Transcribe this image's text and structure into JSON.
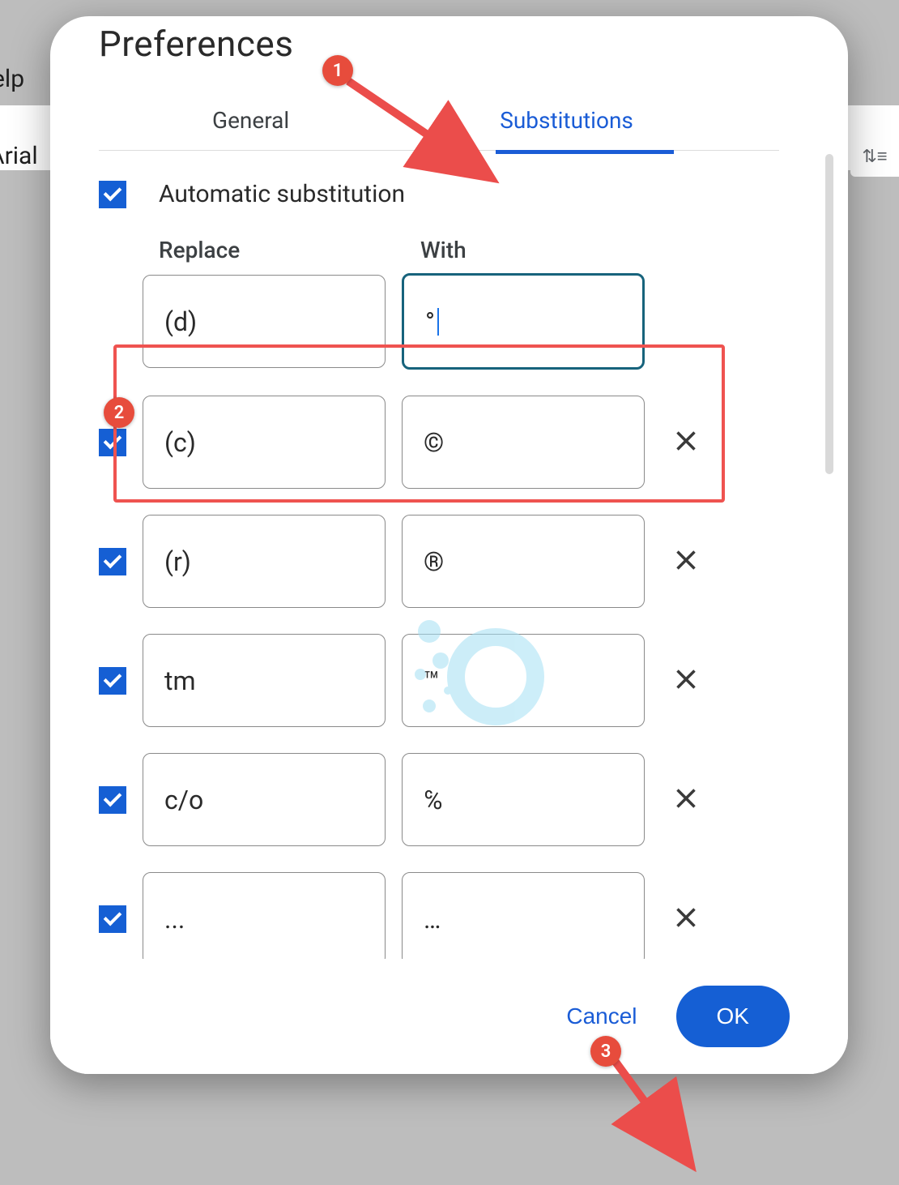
{
  "background": {
    "help_text": "elp",
    "font_text": "Arial"
  },
  "modal": {
    "title": "Preferences",
    "tabs": {
      "general": "General",
      "substitutions": "Substitutions"
    },
    "auto_sub_label": "Automatic substitution",
    "headers": {
      "replace": "Replace",
      "with": "With"
    },
    "new_row": {
      "replace": "(d)",
      "with": "°"
    },
    "rows": [
      {
        "replace": "(c)",
        "with": "©"
      },
      {
        "replace": "(r)",
        "with": "®"
      },
      {
        "replace": "tm",
        "with": "™"
      },
      {
        "replace": "c/o",
        "with": "℅"
      },
      {
        "replace": "...",
        "with": "…"
      }
    ],
    "footer": {
      "cancel": "Cancel",
      "ok": "OK"
    }
  },
  "annotations": {
    "b1": "1",
    "b2": "2",
    "b3": "3"
  }
}
